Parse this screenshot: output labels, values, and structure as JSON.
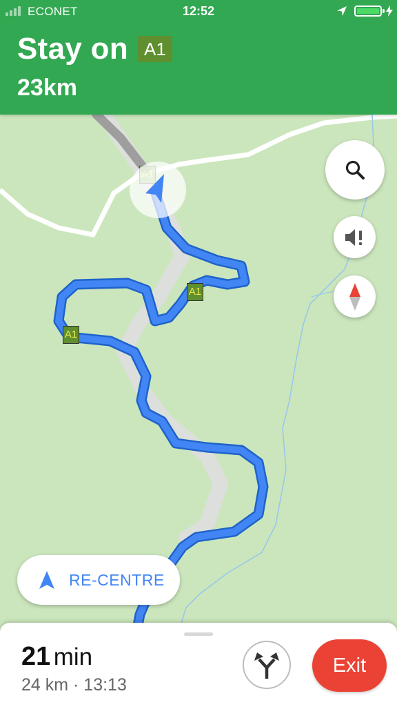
{
  "status_bar": {
    "carrier": "ECONET",
    "time": "12:52"
  },
  "navigation": {
    "instruction": "Stay on",
    "road": "A1",
    "distance": "23km"
  },
  "map": {
    "road_shields": [
      "A1",
      "A1",
      "A1"
    ]
  },
  "buttons": {
    "recentre_label": "RE-CENTRE",
    "exit_label": "Exit"
  },
  "trip": {
    "duration_value": "21",
    "duration_unit": "min",
    "summary": "24 km · 13:13"
  },
  "icons": {
    "search": "search-icon",
    "sound": "volume-alert-icon",
    "compass": "compass-icon",
    "recentre": "navigation-arrow-icon",
    "routes": "alternate-routes-icon",
    "location": "location-arrow-icon",
    "battery": "battery-icon"
  },
  "colors": {
    "header_green": "#33a852",
    "route_blue": "#4285f4",
    "shield_green": "#5f8f2f",
    "shield_text": "#e8e84a",
    "exit_red": "#ea4335",
    "map_green": "#cbe6bd",
    "battery_fill": "#4cd964"
  }
}
